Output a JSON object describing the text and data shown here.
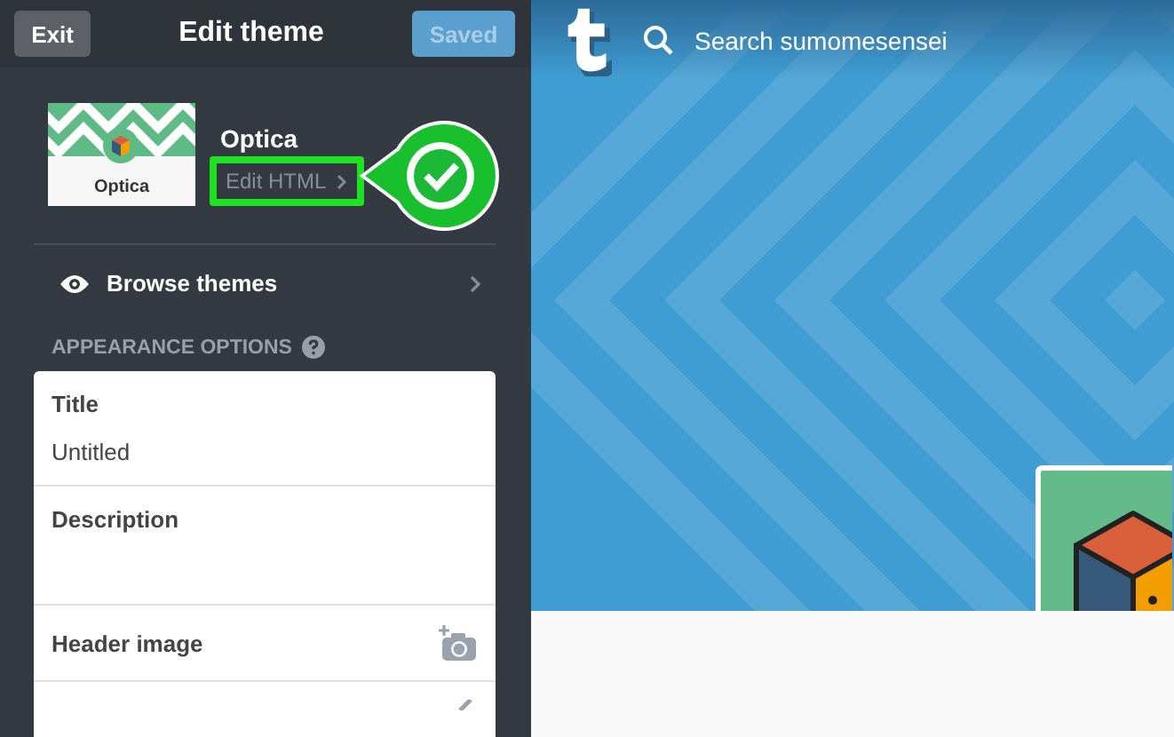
{
  "header": {
    "exit": "Exit",
    "title": "Edit theme",
    "save": {
      "label": "Saved",
      "disabled": true
    }
  },
  "theme": {
    "name": "Optica",
    "thumbnail_label": "Optica",
    "edit_html": "Edit HTML",
    "highlighted": true
  },
  "browse": {
    "label": "Browse themes"
  },
  "appearance": {
    "heading": "APPEARANCE OPTIONS"
  },
  "options": [
    {
      "kind": "text",
      "label": "Title",
      "value": "Untitled"
    },
    {
      "kind": "textarea",
      "label": "Description"
    },
    {
      "kind": "image",
      "label": "Header image"
    },
    {
      "kind": "cut"
    }
  ],
  "preview": {
    "search": {
      "placeholder": "Search sumomesensei"
    }
  }
}
